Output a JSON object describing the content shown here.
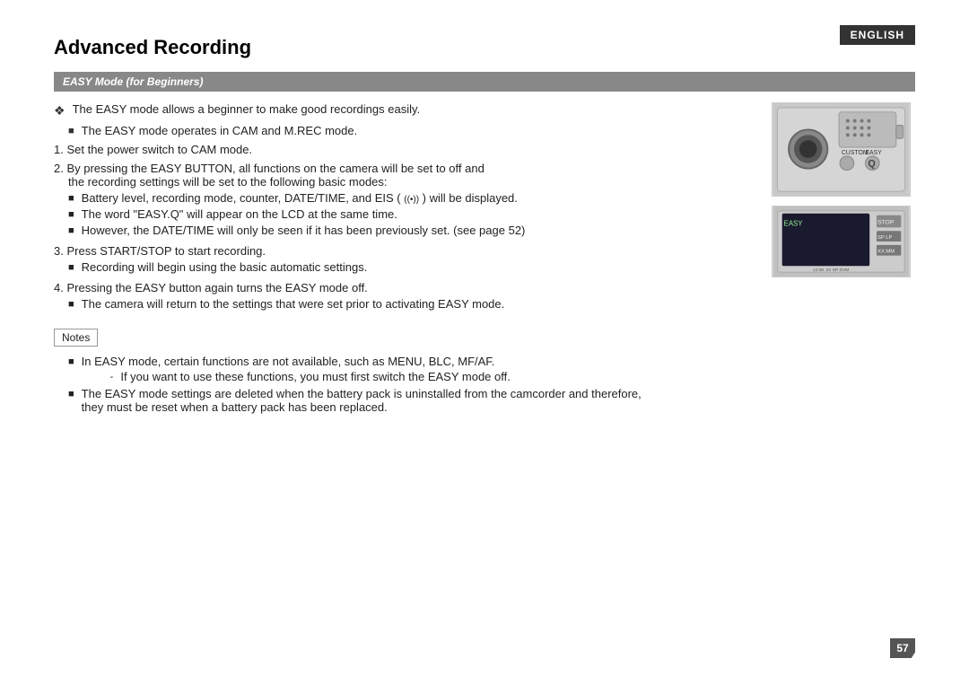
{
  "badge": "ENGLISH",
  "title": "Advanced Recording",
  "section_header": "EASY Mode (for Beginners)",
  "intro": {
    "bullet1": "The EASY mode allows a beginner to make good recordings easily.",
    "bullet1_sub": "The EASY mode operates in CAM and M.REC mode."
  },
  "steps": [
    {
      "num": "1.",
      "text": "Set the power switch to CAM mode."
    },
    {
      "num": "2.",
      "text": "By pressing the EASY BUTTON, all functions on the camera will be set to off and the recording settings will be set to the following basic modes:",
      "subs": [
        "Battery level, recording mode, counter, DATE/TIME, and EIS (  ) will be displayed.",
        "The word “EASY.Q” will appear on the LCD at the same time.",
        "However, the DATE/TIME will only be seen if it has been previously set. (see page 52)"
      ]
    },
    {
      "num": "3.",
      "text": "Press START/STOP to start recording.",
      "subs": [
        "Recording will begin using the basic automatic settings."
      ]
    },
    {
      "num": "4.",
      "text": "Pressing the EASY button again turns the EASY mode off.",
      "subs": [
        "The camera will return to the settings that were set prior to activating EASY mode."
      ]
    }
  ],
  "notes_label": "Notes",
  "notes": [
    {
      "text": "In EASY mode, certain functions are not available, such as MENU, BLC, MF/AF.",
      "sub": "- If you want to use these functions, you must first switch the EASY mode off."
    },
    {
      "text": "The EASY mode settings are deleted when the battery pack is uninstalled from the camcorder and therefore, they must be reset when a battery pack has been replaced."
    }
  ],
  "page_number": "57",
  "camera_labels": {
    "custom": "CUSTOM",
    "easy": "EASY"
  },
  "lcd_labels": {
    "easy": "EASY",
    "stop": "STOP",
    "sp_lp": "SP  LP",
    "mm": "XX:MM"
  }
}
